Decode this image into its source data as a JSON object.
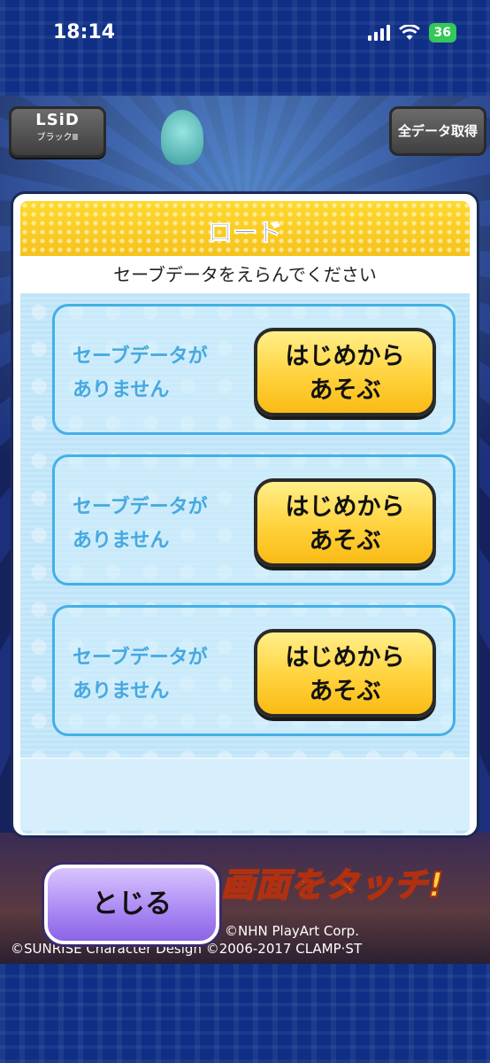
{
  "status_bar": {
    "time": "18:14",
    "battery": "36"
  },
  "game": {
    "lsid_logo": "LSiD",
    "lsid_sub": "ブラックⅢ",
    "all_data_button": "全データ取得",
    "touch_text": "画面をタッチ!",
    "copyright_line1": "©NHN PlayArt Corp.",
    "copyright_line2": "©SUNRISE Character Design ©2006-2017 CLAMP·ST"
  },
  "modal": {
    "title": "ロード",
    "subtitle": "セーブデータをえらんでください",
    "slots": [
      {
        "status_line1": "セーブデータが",
        "status_line2": "ありません",
        "button_line1": "はじめから",
        "button_line2": "あそぶ"
      },
      {
        "status_line1": "セーブデータが",
        "status_line2": "ありません",
        "button_line1": "はじめから",
        "button_line2": "あそぶ"
      },
      {
        "status_line1": "セーブデータが",
        "status_line2": "ありません",
        "button_line1": "はじめから",
        "button_line2": "あそぶ"
      }
    ]
  },
  "close_button": "とじる",
  "colors": {
    "title_blue": "#123a9a",
    "slot_border": "#43b0e6",
    "button_yellow": "#ffd23c",
    "close_purple": "#a987f3"
  }
}
